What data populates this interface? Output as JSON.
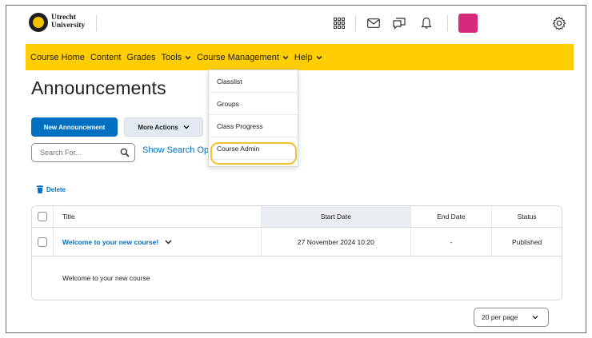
{
  "header": {
    "logo_line1": "Utrecht",
    "logo_line2": "University",
    "icons": [
      "apps-grid-icon",
      "mail-icon",
      "chat-icon",
      "bell-icon",
      "gear-icon"
    ],
    "avatar_color": "#d62a7d"
  },
  "nav": {
    "items": [
      "Course Home",
      "Content",
      "Grades",
      "Tools",
      "Course Management",
      "Help"
    ]
  },
  "page": {
    "title": "Announcements"
  },
  "toolbar": {
    "new_label": "New Announcement",
    "more_label": "More Actions",
    "search_placeholder": "Search For...",
    "show_search_label": "Show Search Op"
  },
  "dropdown": {
    "items": [
      "Classlist",
      "Groups",
      "Class Progress",
      "Course Admin"
    ],
    "highlighted": "Course Admin",
    "highlight_color": "#f2c12e"
  },
  "actions": {
    "delete_label": "Delete"
  },
  "table": {
    "columns": [
      "Title",
      "Start Date",
      "End Date",
      "Status"
    ],
    "rows": [
      {
        "title": "Welcome to your new course!",
        "start": "27 November 2024 10:20",
        "end": "-",
        "status": "Published",
        "description": "Welcome to your new course"
      }
    ]
  },
  "pagination": {
    "per_page": "20 per page"
  },
  "colors": {
    "nav_bg": "#ffcd00",
    "primary": "#006fbf"
  }
}
